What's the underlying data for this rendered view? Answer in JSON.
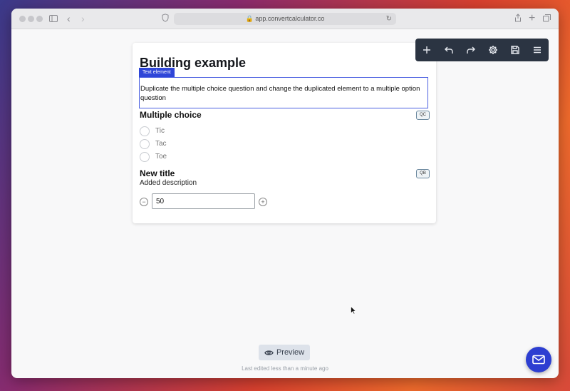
{
  "browser": {
    "url": "app.convertcalculator.co"
  },
  "form": {
    "title": "Building example",
    "text_element": {
      "tag": "Text element",
      "content": "Duplicate the multiple choice question and change the duplicated element to a multiple option question"
    },
    "question1": {
      "title": "Multiple choice",
      "badge": "QC",
      "options": [
        "Tic",
        "Tac",
        "Toe"
      ]
    },
    "question2": {
      "title": "New title",
      "badge": "QB",
      "description": "Added description",
      "value": "50"
    }
  },
  "toolbar": {
    "icons": [
      "plus-icon",
      "undo-icon",
      "redo-icon",
      "gear-icon",
      "save-icon",
      "menu-icon"
    ]
  },
  "footer": {
    "preview_label": "Preview",
    "last_edited": "Last edited less than a minute ago"
  },
  "colors": {
    "accent": "#2f46d8",
    "toolbar_bg": "#2b3442",
    "fab": "#2d3ed1"
  }
}
